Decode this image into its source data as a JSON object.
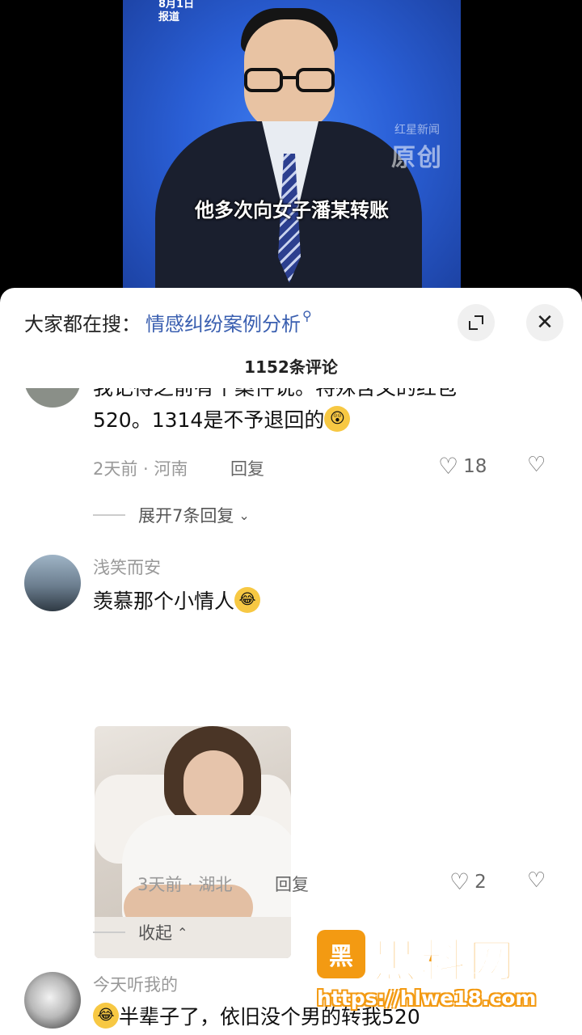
{
  "video": {
    "date_line1": "8月1日",
    "date_line2": "报道",
    "watermark_small": "红星新闻",
    "watermark_big": "原创",
    "subtitle": "他多次向女子潘某转账"
  },
  "sheet": {
    "search_prefix": "大家都在搜：",
    "search_term": "情感纠纷案例分析",
    "comment_count": "1152条评论",
    "close_glyph": "✕"
  },
  "comments": [
    {
      "text_line1": "我记得之前有个案件说。特殊含义的红包",
      "text_line2": "520。1314是不予退回的",
      "emoji": "😲",
      "meta": "2天前 · 河南",
      "reply_label": "回复",
      "likes": "18",
      "thread_toggle": "展开7条回复"
    },
    {
      "username": "浅笑而安",
      "text": "羡慕那个小情人",
      "emoji": "😂",
      "meta": "3天前 · 湖北",
      "reply_label": "回复",
      "likes": "2",
      "thread_toggle": "收起"
    },
    {
      "username": "今天听我的",
      "emoji": "😂",
      "text": "半辈子了，依旧没个男的转我520"
    }
  ],
  "brand": {
    "logo": "黑",
    "name": "黑料网",
    "url": "https://hlwe18.com"
  },
  "colors": {
    "link_blue": "#3a5fb0",
    "brand_orange": "#f39a12",
    "video_blue": "#2a5fd6"
  }
}
